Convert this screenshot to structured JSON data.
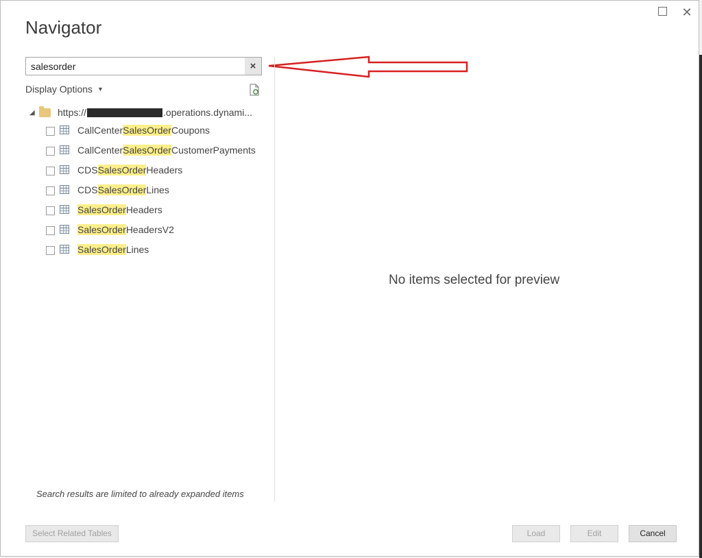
{
  "window": {
    "title": "Navigator",
    "maximize_icon": "maximize-icon",
    "close_icon": "close-icon"
  },
  "search": {
    "value": "salesorder",
    "clear_icon": "×"
  },
  "display_options": {
    "label": "Display Options",
    "caret": "▼"
  },
  "tree": {
    "root": {
      "expander": "◢",
      "url_prefix": "https://",
      "url_suffix": ".operations.dynami..."
    },
    "items": [
      {
        "pre": "CallCenter",
        "match": "SalesOrder",
        "post": "Coupons"
      },
      {
        "pre": "CallCenter",
        "match": "SalesOrder",
        "post": "CustomerPayments"
      },
      {
        "pre": "CDS",
        "match": "SalesOrder",
        "post": "Headers"
      },
      {
        "pre": "CDS",
        "match": "SalesOrder",
        "post": "Lines"
      },
      {
        "pre": "",
        "match": "SalesOrder",
        "post": "Headers"
      },
      {
        "pre": "",
        "match": "SalesOrder",
        "post": "HeadersV2"
      },
      {
        "pre": "",
        "match": "SalesOrder",
        "post": "Lines"
      }
    ]
  },
  "search_note": "Search results are limited to already expanded items",
  "preview": {
    "message": "No items selected for preview"
  },
  "buttons": {
    "select_related": "Select Related Tables",
    "load": "Load",
    "edit": "Edit",
    "cancel": "Cancel"
  },
  "colors": {
    "highlight": "#fcef8a",
    "arrow": "#d62020"
  }
}
